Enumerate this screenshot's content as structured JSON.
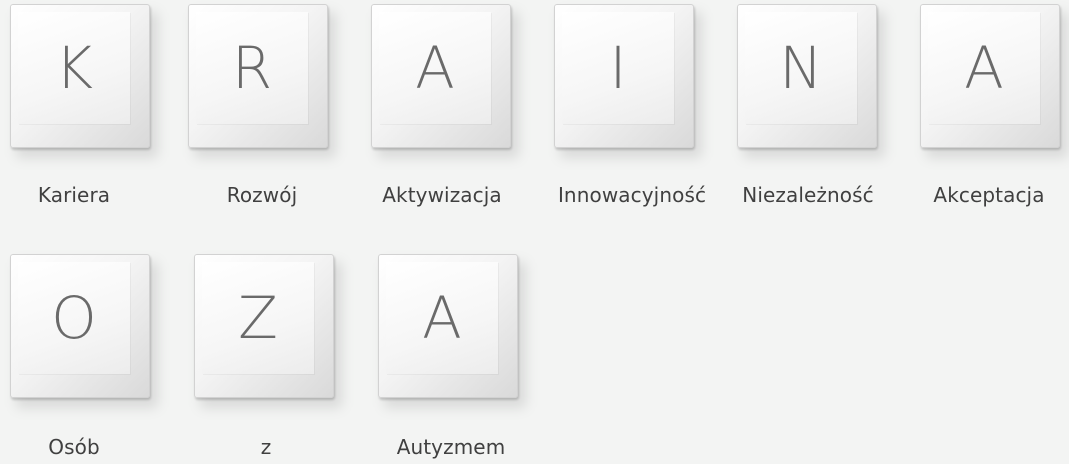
{
  "keys": [
    {
      "letter": "K",
      "word": "Kariera"
    },
    {
      "letter": "R",
      "word": "Rozwój"
    },
    {
      "letter": "A",
      "word": "Aktywizacja"
    },
    {
      "letter": "I",
      "word": "Innowacyjność"
    },
    {
      "letter": "N",
      "word": "Niezależność"
    },
    {
      "letter": "A",
      "word": "Akceptacja"
    },
    {
      "letter": "O",
      "word": "Osób"
    },
    {
      "letter": "Z",
      "word": "z"
    },
    {
      "letter": "A",
      "word": "Autyzmem"
    }
  ]
}
